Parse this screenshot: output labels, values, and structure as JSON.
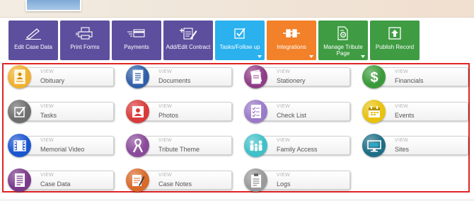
{
  "toolbar": {
    "buttons": [
      {
        "label": "Edit Case Data",
        "icon": "pencil-icon",
        "color": "#5d4f9e",
        "dropdown": false
      },
      {
        "label": "Print Forms",
        "icon": "printer-icon",
        "color": "#5d4f9e",
        "dropdown": false
      },
      {
        "label": "Payments",
        "icon": "credit-card-icon",
        "color": "#5d4f9e",
        "dropdown": false
      },
      {
        "label": "Add/Edit Contract",
        "icon": "contract-icon",
        "color": "#5d4f9e",
        "dropdown": false
      },
      {
        "label": "Tasks/Follow up",
        "icon": "checkbox-icon",
        "color": "#2ab1ee",
        "dropdown": true
      },
      {
        "label": "Integrations",
        "icon": "plug-icon",
        "color": "#f2812a",
        "dropdown": true
      },
      {
        "label": "Manage Tribute Page",
        "icon": "page-settings-icon",
        "color": "#3f9c43",
        "dropdown": true
      },
      {
        "label": "Publish Record",
        "icon": "publish-icon",
        "color": "#3f9c43",
        "dropdown": false
      }
    ]
  },
  "tiles": {
    "view_text": "VIEW",
    "items": [
      {
        "label": "Obituary",
        "icon": "obituary-icon",
        "color": "#f0b030"
      },
      {
        "label": "Documents",
        "icon": "documents-icon",
        "color": "#2f5fa8"
      },
      {
        "label": "Stationery",
        "icon": "stationery-icon",
        "color": "#8e3d86"
      },
      {
        "label": "Financials",
        "icon": "dollar-icon",
        "color": "#3a9a3a"
      },
      {
        "label": "Tasks",
        "icon": "checkbox-icon",
        "color": "#6e6e6e"
      },
      {
        "label": "Photos",
        "icon": "photo-icon",
        "color": "#d93a3a"
      },
      {
        "label": "Check List",
        "icon": "checklist-icon",
        "color": "#9a7ac8"
      },
      {
        "label": "Events",
        "icon": "calendar-icon",
        "color": "#e8c20e"
      },
      {
        "label": "Memorial Video",
        "icon": "film-icon",
        "color": "#1a55d0"
      },
      {
        "label": "Tribute Theme",
        "icon": "ribbon-icon",
        "color": "#8a4a9a"
      },
      {
        "label": "Family Access",
        "icon": "family-icon",
        "color": "#40c0c8"
      },
      {
        "label": "Sites",
        "icon": "monitor-icon",
        "color": "#1e6e86"
      },
      {
        "label": "Case Data",
        "icon": "case-data-icon",
        "color": "#7a3a8a"
      },
      {
        "label": "Case Notes",
        "icon": "notes-icon",
        "color": "#d96a2a"
      },
      {
        "label": "Logs",
        "icon": "clipboard-icon",
        "color": "#9a9a9a"
      }
    ]
  }
}
